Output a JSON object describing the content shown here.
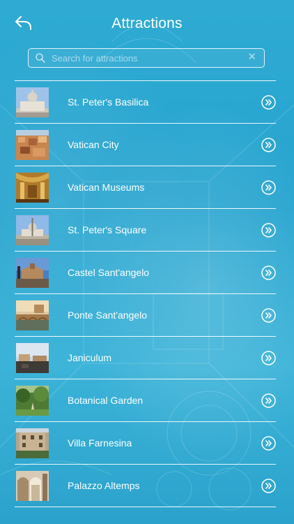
{
  "header": {
    "title": "Attractions",
    "back_icon": "back-arrow-icon"
  },
  "search": {
    "placeholder": "Search for attractions",
    "value": "",
    "search_icon": "search-icon",
    "clear_icon": "clear-icon"
  },
  "attractions": [
    {
      "label": "St. Peter's Basilica",
      "thumb": "basilica-photo"
    },
    {
      "label": "Vatican City",
      "thumb": "vatican-city-photo"
    },
    {
      "label": "Vatican Museums",
      "thumb": "museums-photo"
    },
    {
      "label": "St. Peter's Square",
      "thumb": "square-photo"
    },
    {
      "label": "Castel Sant'angelo",
      "thumb": "castel-photo"
    },
    {
      "label": "Ponte Sant'angelo",
      "thumb": "ponte-photo"
    },
    {
      "label": "Janiculum",
      "thumb": "janiculum-photo"
    },
    {
      "label": "Botanical Garden",
      "thumb": "garden-photo"
    },
    {
      "label": "Villa Farnesina",
      "thumb": "villa-photo"
    },
    {
      "label": "Palazzo Altemps",
      "thumb": "palazzo-photo"
    }
  ],
  "colors": {
    "background": "#2aa7cf",
    "foreground": "#ffffff"
  }
}
